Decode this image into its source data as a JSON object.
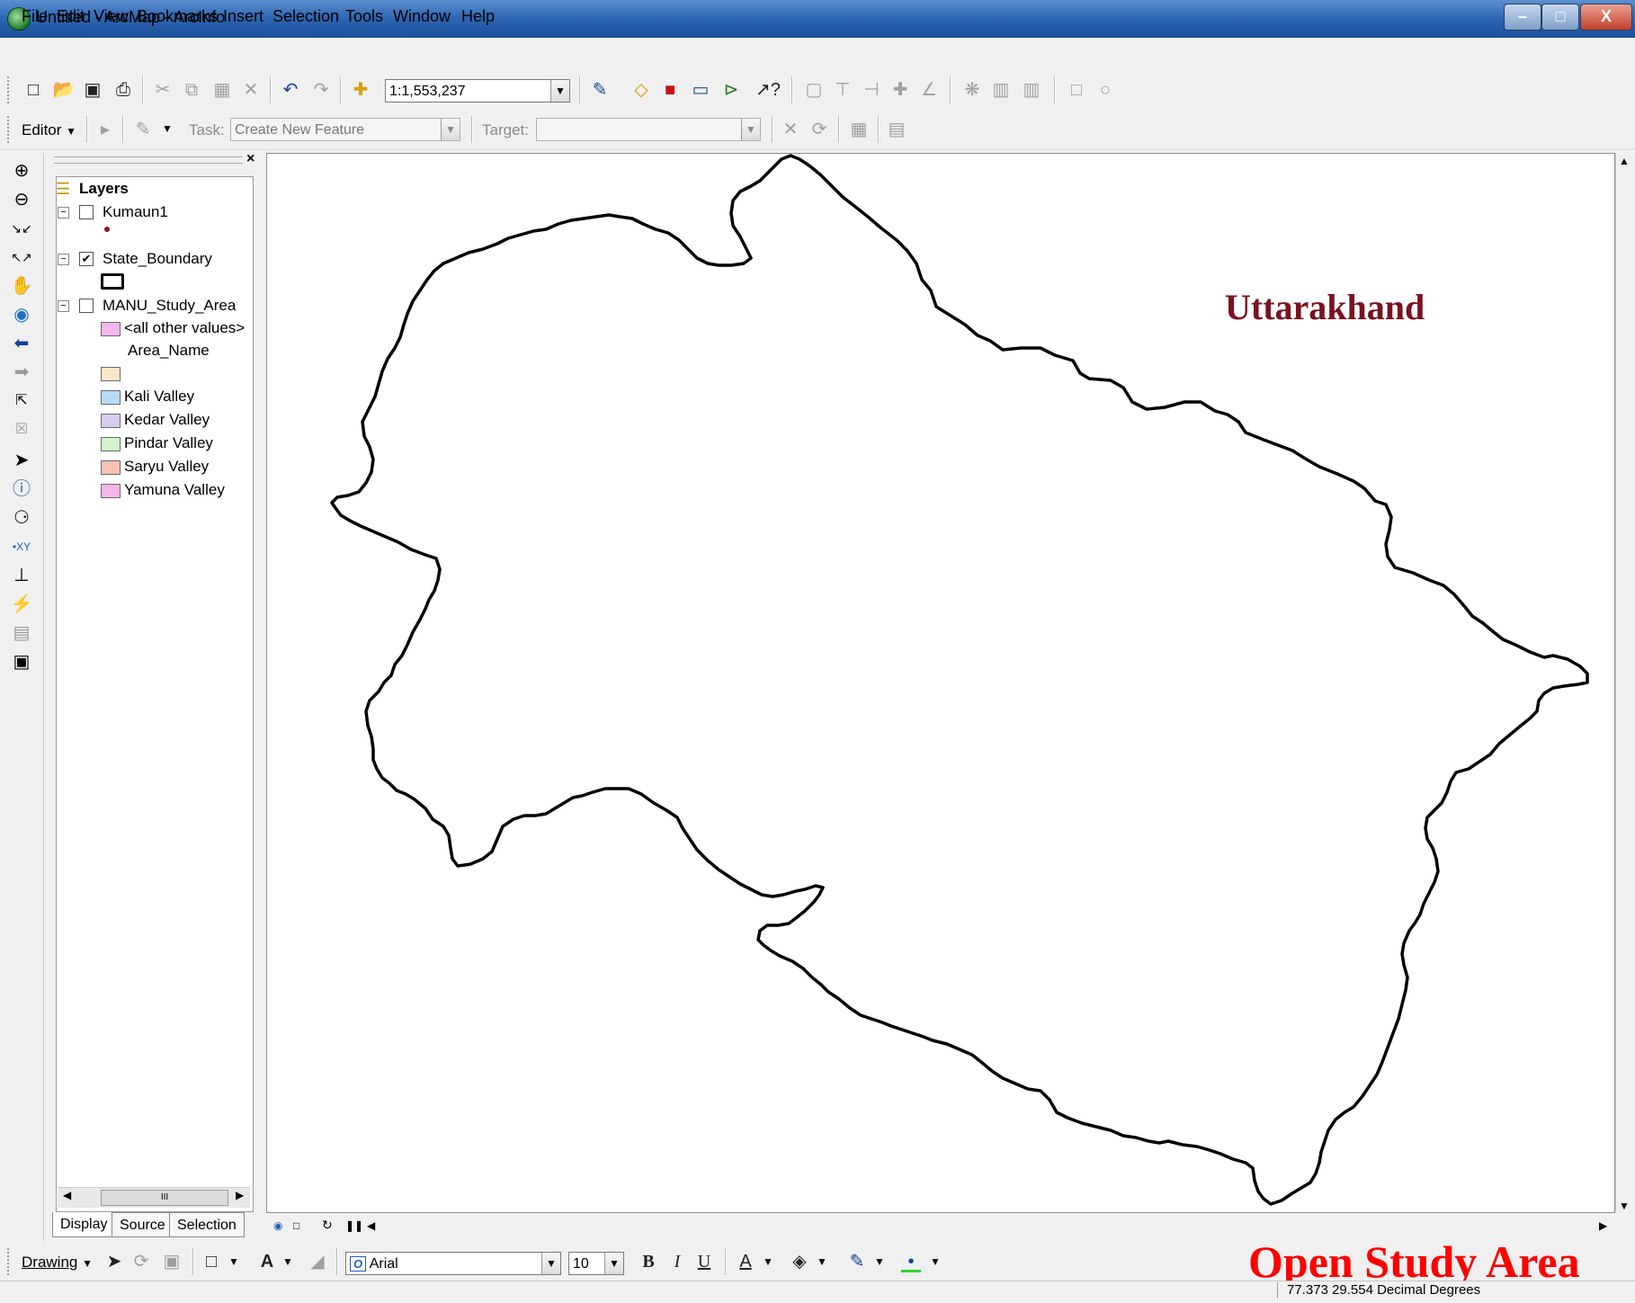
{
  "window": {
    "title": "Untitled - ArcMap - ArcInfo",
    "min_glyph": "–",
    "max_glyph": "□",
    "close_glyph": "X"
  },
  "menu": [
    "File",
    "Edit",
    "View",
    "Bookmarks",
    "Insert",
    "Selection",
    "Tools",
    "Window",
    "Help"
  ],
  "standard_toolbar": {
    "scale": "1:1,553,237"
  },
  "editor_toolbar": {
    "editor_label": "Editor",
    "task_label": "Task:",
    "task_value": "Create New Feature",
    "target_label": "Target:",
    "target_value": ""
  },
  "toc": {
    "root": "Layers",
    "layers": [
      {
        "name": "Kumaun1",
        "checked": false
      },
      {
        "name": "State_Boundary",
        "checked": true
      },
      {
        "name": "MANU_Study_Area",
        "checked": false
      }
    ],
    "legend_other": "<all other values>",
    "legend_field": "Area_Name",
    "legend_items": [
      {
        "label": "",
        "color": "#fde5c8"
      },
      {
        "label": "Kali Valley",
        "color": "#b6dcf5"
      },
      {
        "label": "Kedar Valley",
        "color": "#d8ccf3"
      },
      {
        "label": "Pindar Valley",
        "color": "#d4f3cc"
      },
      {
        "label": "Saryu Valley",
        "color": "#f7c2b2"
      },
      {
        "label": "Yamuna Valley",
        "color": "#f3b6e6"
      }
    ],
    "legend_other_color": "#f3b6ee",
    "tabs": [
      "Display",
      "Source",
      "Selection"
    ]
  },
  "map": {
    "title": "Uttarakhand"
  },
  "drawing_toolbar": {
    "drawing_label": "Drawing",
    "font": "Arial",
    "size": "10"
  },
  "overlay": {
    "caption": "Open Study Area"
  },
  "status": {
    "coords": "77.373  29.554 Decimal Degrees"
  }
}
